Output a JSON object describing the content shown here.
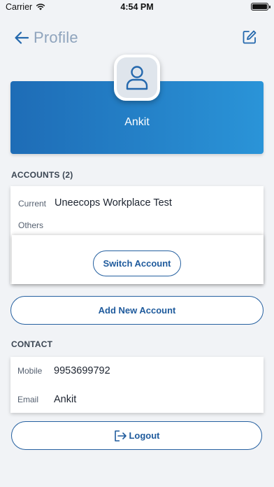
{
  "status_bar": {
    "carrier": "Carrier",
    "time": "4:54 PM"
  },
  "nav": {
    "title": "Profile"
  },
  "profile": {
    "name": "Ankit"
  },
  "accounts": {
    "title": "ACCOUNTS (2)",
    "current_label": "Current",
    "current_value": "Uneecops Workplace Test",
    "others_label": "Others",
    "switch_label": "Switch Account",
    "add_label": "Add New Account"
  },
  "contact": {
    "title": "CONTACT",
    "mobile_label": "Mobile",
    "mobile_value": "9953699792",
    "email_label": "Email",
    "email_value": "Ankit"
  },
  "logout_label": "Logout",
  "colors": {
    "accent": "#1e5a9c",
    "hero_start": "#1e6cb6",
    "hero_end": "#2a94d8",
    "background": "#f1f3f6"
  }
}
